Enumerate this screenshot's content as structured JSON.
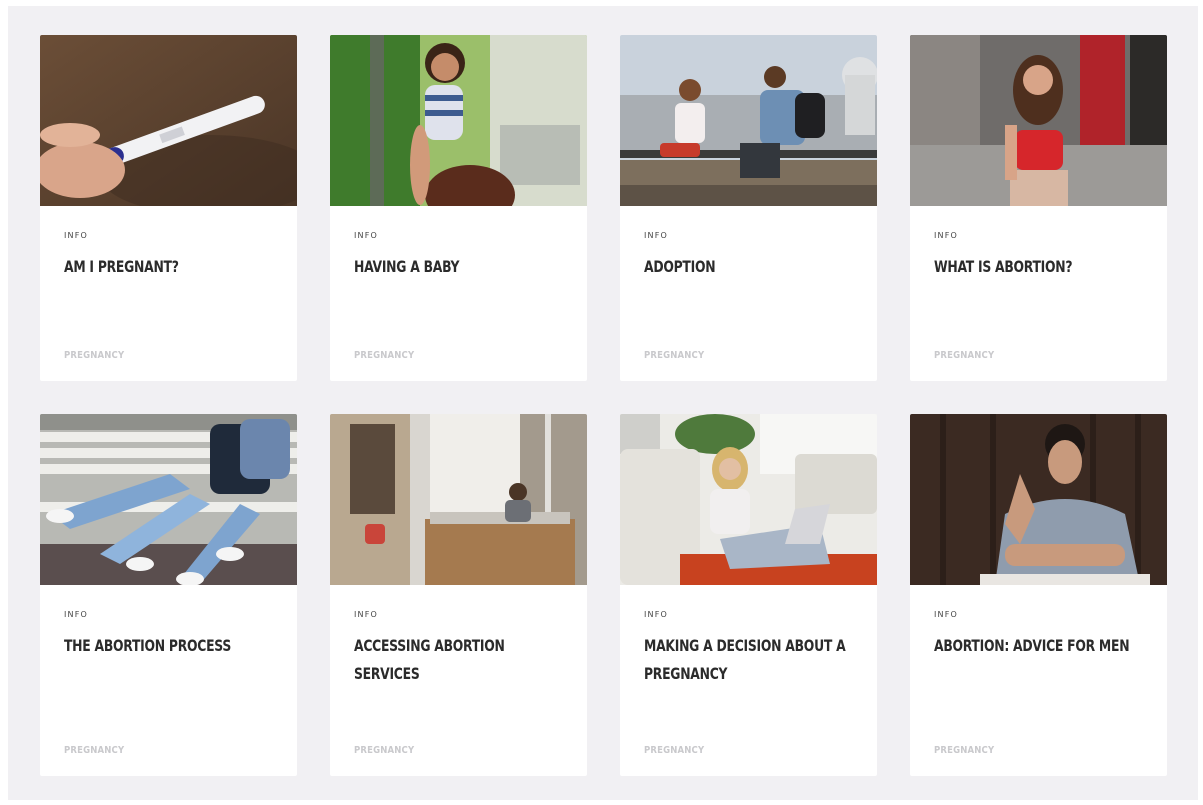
{
  "cards": [
    {
      "category": "INFO",
      "title": "AM I PREGNANT?",
      "tag": "PREGNANCY"
    },
    {
      "category": "INFO",
      "title": "HAVING A BABY",
      "tag": "PREGNANCY"
    },
    {
      "category": "INFO",
      "title": "ADOPTION",
      "tag": "PREGNANCY"
    },
    {
      "category": "INFO",
      "title": "WHAT IS ABORTION?",
      "tag": "PREGNANCY"
    },
    {
      "category": "INFO",
      "title": "THE ABORTION PROCESS",
      "tag": "PREGNANCY"
    },
    {
      "category": "INFO",
      "title": "ACCESSING ABORTION SERVICES",
      "tag": "PREGNANCY"
    },
    {
      "category": "INFO",
      "title": "MAKING A DECISION ABOUT A PREGNANCY",
      "tag": "PREGNANCY"
    },
    {
      "category": "INFO",
      "title": "ABORTION: ADVICE FOR MEN",
      "tag": "PREGNANCY"
    }
  ]
}
